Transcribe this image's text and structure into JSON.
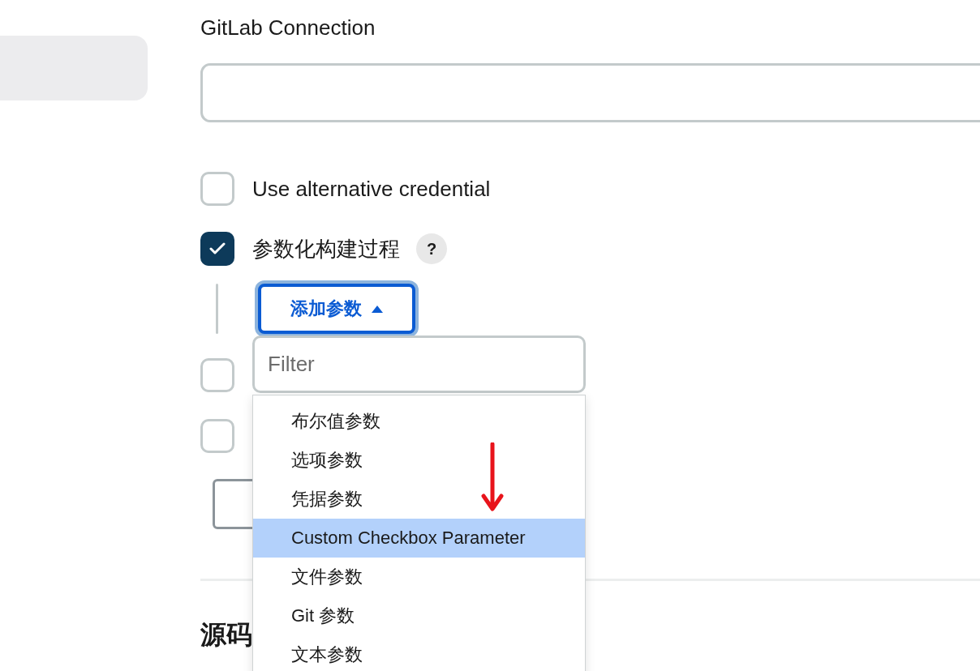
{
  "sidebar": {
    "items": [
      {
        "selected": true
      }
    ]
  },
  "gitlab_connection": {
    "label": "GitLab Connection"
  },
  "options": [
    {
      "label": "Use alternative credential",
      "checked": false
    },
    {
      "label": "参数化构建过程",
      "checked": true,
      "help": "?"
    }
  ],
  "add_parameter": {
    "label": "添加参数",
    "expanded": true,
    "filter": {
      "placeholder": "Filter"
    },
    "menu": [
      {
        "label": "布尔值参数",
        "selected": false
      },
      {
        "label": "选项参数",
        "selected": false
      },
      {
        "label": "凭据参数",
        "selected": false
      },
      {
        "label": "Custom Checkbox Parameter",
        "selected": true
      },
      {
        "label": "文件参数",
        "selected": false
      },
      {
        "label": "Git 参数",
        "selected": false
      },
      {
        "label": "文本参数",
        "selected": false
      }
    ]
  },
  "hidden_options": [
    {
      "checked": false
    },
    {
      "checked": false
    }
  ],
  "section_heading": "源码"
}
